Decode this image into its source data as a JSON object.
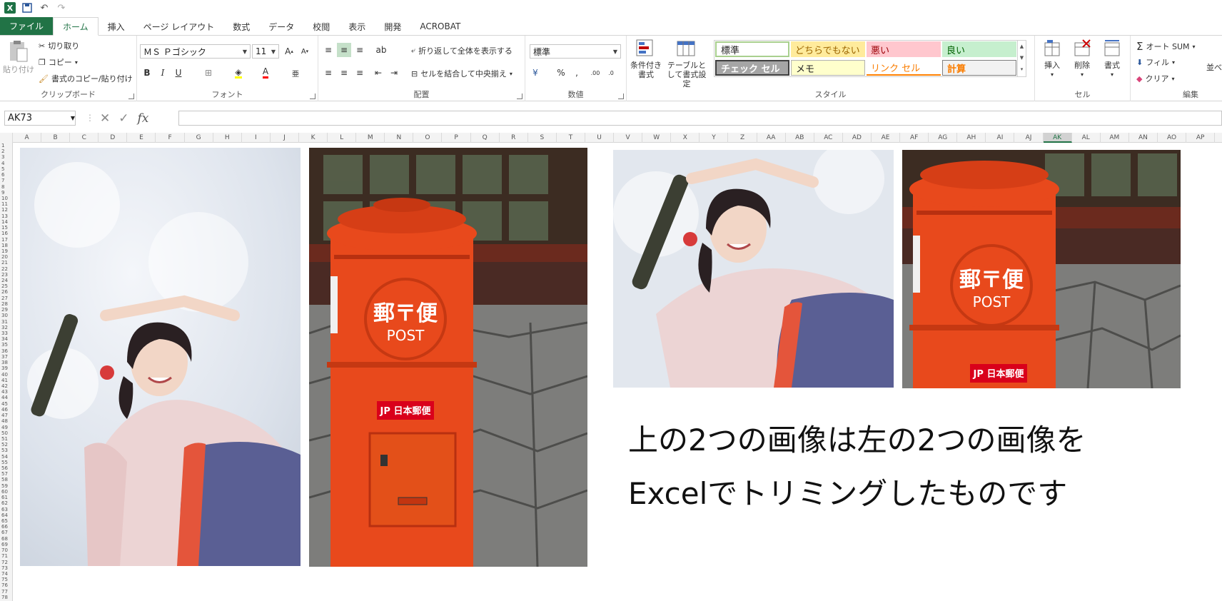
{
  "qat": {
    "app_icon": "X"
  },
  "tabs": [
    "ファイル",
    "ホーム",
    "挿入",
    "ページ レイアウト",
    "数式",
    "データ",
    "校閲",
    "表示",
    "開発",
    "ACROBAT"
  ],
  "ribbon": {
    "clipboard": {
      "paste": "貼り付け",
      "cut": "切り取り",
      "copy": "コピー",
      "format_painter": "書式のコピー/貼り付け",
      "label": "クリップボード"
    },
    "font": {
      "name": "ＭＳ Ｐゴシック",
      "size": "11",
      "label": "フォント"
    },
    "alignment": {
      "wrap": "折り返して全体を表示する",
      "merge": "セルを結合して中央揃え",
      "label": "配置"
    },
    "number": {
      "format": "標準",
      "label": "数値"
    },
    "styles": {
      "conditional": "条件付き書式",
      "table": "テーブルとして書式設定",
      "label": "スタイル",
      "cells": [
        "標準",
        "どちらでもない",
        "悪い",
        "良い",
        "チェック セル",
        "メモ",
        "リンク セル",
        "計算"
      ]
    },
    "cells": {
      "insert": "挿入",
      "delete": "削除",
      "format": "書式",
      "label": "セル"
    },
    "editing": {
      "autosum": "オート SUM",
      "fill": "フィル",
      "clear": "クリア",
      "sort": "並べ",
      "label": "編集"
    }
  },
  "formula_bar": {
    "name_box": "AK73",
    "fx": "fx",
    "value": ""
  },
  "columns": [
    "A",
    "B",
    "C",
    "D",
    "E",
    "F",
    "G",
    "H",
    "I",
    "J",
    "K",
    "L",
    "M",
    "N",
    "O",
    "P",
    "Q",
    "R",
    "S",
    "T",
    "U",
    "V",
    "W",
    "X",
    "Y",
    "Z",
    "AA",
    "AB",
    "AC",
    "AD",
    "AE",
    "AF",
    "AG",
    "AH",
    "AI",
    "AJ",
    "AK",
    "AL",
    "AM",
    "AN",
    "AO",
    "AP"
  ],
  "active_column": "AK",
  "caption": {
    "line1": "上の2つの画像は左の2つの画像を",
    "line2": "Excelでトリミングしたものです"
  }
}
